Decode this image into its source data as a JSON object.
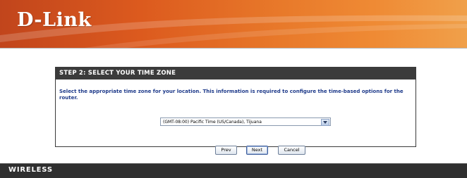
{
  "header": {
    "logo_text": "D-Link",
    "brand_color": "#dc5a1e"
  },
  "wizard": {
    "title": "STEP 2: SELECT YOUR TIME ZONE",
    "description": "Select the appropriate time zone for your location. This information is required to configure the time-based options for the router.",
    "timezone_select": {
      "selected": "(GMT-08:00) Pacific Time (US/Canada), Tijuana"
    },
    "buttons": {
      "prev": "Prev",
      "next": "Next",
      "cancel": "Cancel"
    }
  },
  "footer": {
    "label": "WIRELESS"
  }
}
